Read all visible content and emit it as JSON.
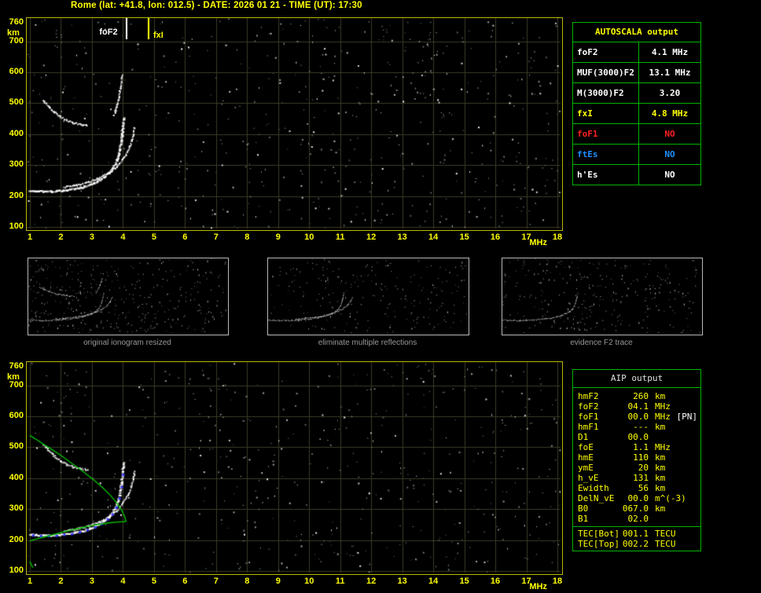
{
  "header": {
    "title": "Rome (lat: +41.8, lon: 012.5) - DATE: 2026 01 21 - TIME (UT): 17:30"
  },
  "colors": {
    "accent_yellow": "#ffff00",
    "grid": "#3b3b28",
    "trace_white": "#ffffff",
    "profile_green": "#00c000",
    "scaled_blue": "#3333ff",
    "plot_border": "#b9b900",
    "table_border": "#00b400",
    "status_red": "#ff2020",
    "status_blue": "#2090ff",
    "caption_gray": "#989898"
  },
  "autoscala_table": {
    "title": "AUTOSCALA output",
    "rows": [
      {
        "label": "foF2",
        "value": "4.1 MHz",
        "color": "#ffffff"
      },
      {
        "label": "MUF(3000)F2",
        "value": "13.1 MHz",
        "color": "#ffffff"
      },
      {
        "label": "M(3000)F2",
        "value": "3.20",
        "color": "#ffffff"
      },
      {
        "label": "fxI",
        "value": "4.8 MHz",
        "color": "#ffff00"
      },
      {
        "label": "foF1",
        "value": "NO",
        "color": "#ff2020"
      },
      {
        "label": "ftEs",
        "value": "NO",
        "color": "#2090ff"
      },
      {
        "label": "h'Es",
        "value": "NO",
        "color": "#ffffff"
      }
    ]
  },
  "thumbnails": [
    {
      "caption": "original ionogram resized",
      "trace_keys": [
        "f2_main",
        "f2_xmode",
        "second_hop",
        "second_hop_cusp"
      ]
    },
    {
      "caption": "eliminate multiple reflections",
      "trace_keys": [
        "f2_main",
        "f2_xmode"
      ]
    },
    {
      "caption": "evidence F2 trace",
      "trace_keys": [
        "f2_main"
      ]
    }
  ],
  "aip_table": {
    "title": "AIP output",
    "rows": [
      {
        "label": "hmF2",
        "value": "260",
        "unit": "km"
      },
      {
        "label": "foF2",
        "value": "04.1",
        "unit": "MHz"
      },
      {
        "label": "foF1",
        "value": "00.0",
        "unit": "MHz",
        "note": "[PN]"
      },
      {
        "label": "hmF1",
        "value": "---",
        "unit": "km"
      },
      {
        "label": "D1",
        "value": "00.0",
        "unit": ""
      },
      {
        "label": "foE",
        "value": "1.1",
        "unit": "MHz"
      },
      {
        "label": "hmE",
        "value": "110",
        "unit": "km"
      },
      {
        "label": "ymE",
        "value": "20",
        "unit": "km"
      },
      {
        "label": "h_vE",
        "value": "131",
        "unit": "km"
      },
      {
        "label": "Ewidth",
        "value": "56",
        "unit": "km"
      },
      {
        "label": "DelN_vE",
        "value": "00.0",
        "unit": "m^(-3)"
      },
      {
        "label": "B0",
        "value": "067.0",
        "unit": "km"
      },
      {
        "label": "B1",
        "value": "02.0",
        "unit": ""
      }
    ],
    "tec_rows": [
      {
        "label": "TEC[Bot]",
        "value": "001.1",
        "unit": "TECU"
      },
      {
        "label": "TEC[Top]",
        "value": "002.2",
        "unit": "TECU"
      }
    ]
  },
  "chart_data": [
    {
      "type": "scatter",
      "title": "ionogram with AUTOSCALA markers",
      "xlabel": "MHz",
      "ylabel": "km",
      "xlim": [
        1,
        18
      ],
      "ylim": [
        100,
        772
      ],
      "x_ticks": [
        1,
        2,
        3,
        4,
        5,
        6,
        7,
        8,
        9,
        10,
        11,
        12,
        13,
        14,
        15,
        16,
        17,
        18
      ],
      "y_ticks": [
        760,
        700,
        600,
        500,
        400,
        300,
        200,
        100
      ],
      "grid": true,
      "markers": [
        {
          "label": "foF2",
          "freq": 4.1,
          "color": "#ffffff"
        },
        {
          "label": "fxI",
          "freq": 4.8,
          "color": "#ffff00"
        }
      ],
      "traces": {
        "f2_main": [
          [
            1.0,
            218
          ],
          [
            1.2,
            216
          ],
          [
            1.45,
            214
          ],
          [
            1.7,
            214
          ],
          [
            1.95,
            216
          ],
          [
            2.2,
            219
          ],
          [
            2.45,
            223
          ],
          [
            2.7,
            228
          ],
          [
            2.95,
            236
          ],
          [
            3.2,
            247
          ],
          [
            3.4,
            260
          ],
          [
            3.55,
            274
          ],
          [
            3.7,
            292
          ],
          [
            3.82,
            316
          ],
          [
            3.9,
            345
          ],
          [
            3.96,
            382
          ],
          [
            4.0,
            420
          ],
          [
            4.03,
            452
          ]
        ],
        "f2_xmode": [
          [
            2.1,
            228
          ],
          [
            2.5,
            235
          ],
          [
            2.9,
            245
          ],
          [
            3.25,
            258
          ],
          [
            3.55,
            274
          ],
          [
            3.8,
            294
          ],
          [
            4.0,
            318
          ],
          [
            4.18,
            348
          ],
          [
            4.3,
            382
          ],
          [
            4.38,
            420
          ]
        ],
        "second_hop": [
          [
            1.45,
            508
          ],
          [
            1.62,
            488
          ],
          [
            1.8,
            470
          ],
          [
            2.0,
            455
          ],
          [
            2.2,
            444
          ],
          [
            2.42,
            436
          ],
          [
            2.65,
            430
          ],
          [
            2.85,
            427
          ]
        ],
        "second_hop_cusp": [
          [
            3.72,
            462
          ],
          [
            3.8,
            488
          ],
          [
            3.87,
            518
          ],
          [
            3.93,
            552
          ],
          [
            3.97,
            590
          ]
        ]
      }
    },
    {
      "type": "scatter",
      "title": "ionogram with AIP electron density profile",
      "xlabel": "MHz",
      "ylabel": "km",
      "xlim": [
        1,
        18
      ],
      "ylim": [
        100,
        772
      ],
      "x_ticks": [
        1,
        2,
        3,
        4,
        5,
        6,
        7,
        8,
        9,
        10,
        11,
        12,
        13,
        14,
        15,
        16,
        17,
        18
      ],
      "y_ticks": [
        760,
        700,
        600,
        500,
        400,
        300,
        200,
        100
      ],
      "grid": true,
      "traces": {
        "f2_main": [
          [
            1.0,
            218
          ],
          [
            1.2,
            216
          ],
          [
            1.45,
            214
          ],
          [
            1.7,
            214
          ],
          [
            1.95,
            216
          ],
          [
            2.2,
            219
          ],
          [
            2.45,
            223
          ],
          [
            2.7,
            228
          ],
          [
            2.95,
            236
          ],
          [
            3.2,
            247
          ],
          [
            3.4,
            260
          ],
          [
            3.55,
            274
          ],
          [
            3.7,
            292
          ],
          [
            3.82,
            316
          ],
          [
            3.9,
            345
          ],
          [
            3.96,
            382
          ],
          [
            4.0,
            420
          ],
          [
            4.03,
            452
          ]
        ],
        "f2_xmode": [
          [
            2.1,
            228
          ],
          [
            2.5,
            235
          ],
          [
            2.9,
            245
          ],
          [
            3.25,
            258
          ],
          [
            3.55,
            274
          ],
          [
            3.8,
            294
          ],
          [
            4.0,
            318
          ],
          [
            4.18,
            348
          ],
          [
            4.3,
            382
          ],
          [
            4.38,
            420
          ]
        ],
        "second_hop": [
          [
            1.45,
            508
          ],
          [
            1.62,
            488
          ],
          [
            1.8,
            470
          ],
          [
            2.0,
            455
          ],
          [
            2.2,
            444
          ],
          [
            2.42,
            436
          ],
          [
            2.65,
            430
          ],
          [
            2.85,
            427
          ]
        ]
      },
      "scaled_points": [
        [
          1.1,
          216
        ],
        [
          1.35,
          214
        ],
        [
          1.6,
          214
        ],
        [
          1.85,
          215
        ],
        [
          2.1,
          218
        ],
        [
          2.35,
          221
        ],
        [
          2.6,
          226
        ],
        [
          2.85,
          233
        ],
        [
          3.1,
          242
        ],
        [
          3.3,
          253
        ],
        [
          3.5,
          268
        ],
        [
          3.65,
          284
        ],
        [
          3.78,
          306
        ],
        [
          3.88,
          336
        ],
        [
          3.95,
          372
        ],
        [
          4.0,
          412
        ]
      ],
      "profile_bottomside": [
        [
          1.0,
          197
        ],
        [
          1.2,
          203
        ],
        [
          1.5,
          211
        ],
        [
          1.85,
          220
        ],
        [
          2.2,
          229
        ],
        [
          2.55,
          237
        ],
        [
          2.9,
          245
        ],
        [
          3.25,
          251
        ],
        [
          3.6,
          256
        ],
        [
          3.9,
          259
        ],
        [
          4.1,
          260
        ]
      ],
      "profile_topside": [
        [
          4.1,
          260
        ],
        [
          4.05,
          278
        ],
        [
          3.95,
          298
        ],
        [
          3.8,
          320
        ],
        [
          3.6,
          344
        ],
        [
          3.35,
          369
        ],
        [
          3.05,
          395
        ],
        [
          2.72,
          421
        ],
        [
          2.38,
          446
        ],
        [
          2.05,
          470
        ],
        [
          1.72,
          492
        ],
        [
          1.42,
          511
        ],
        [
          1.18,
          527
        ],
        [
          1.0,
          538
        ]
      ],
      "profile_e": [
        [
          1.0,
          131
        ],
        [
          1.05,
          120
        ],
        [
          1.1,
          110
        ]
      ]
    }
  ]
}
